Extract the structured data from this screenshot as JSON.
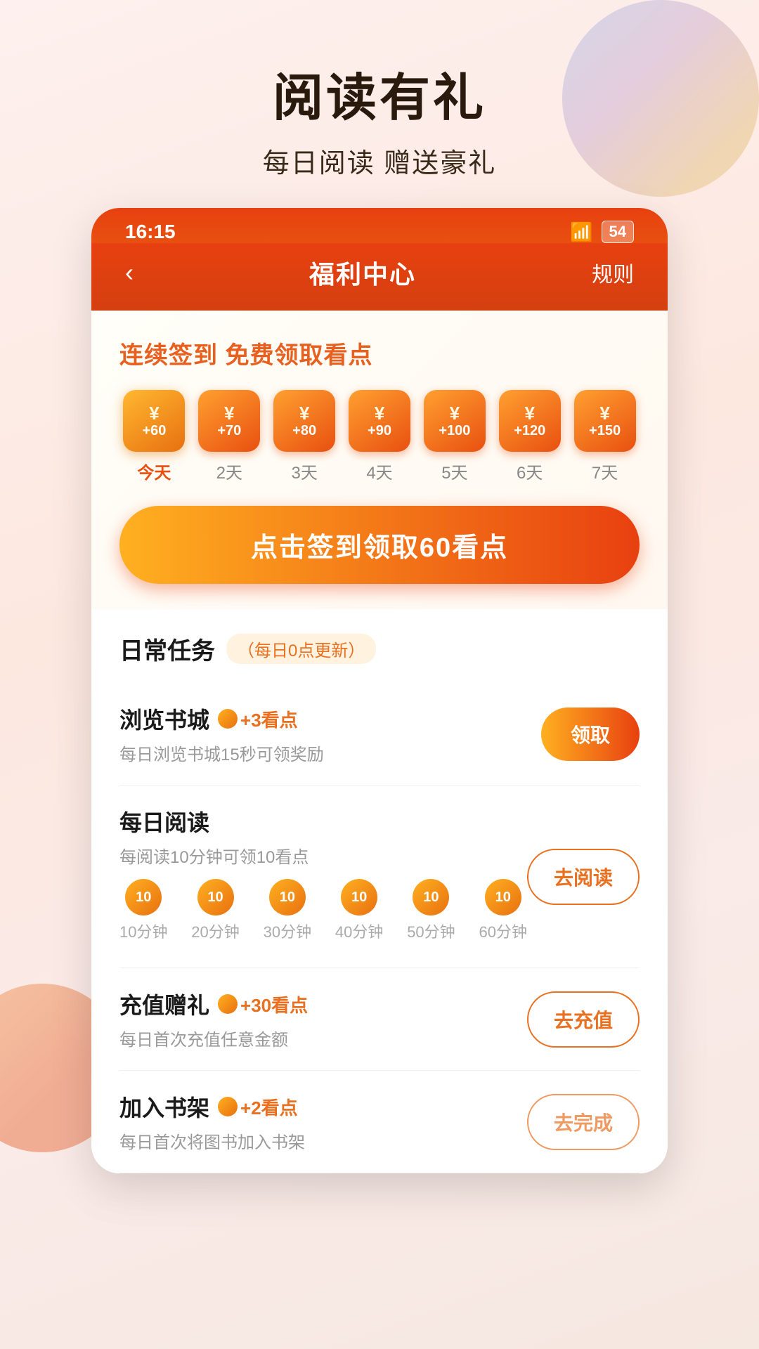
{
  "page": {
    "title": "阅读有礼",
    "subtitle": "每日阅读  赠送豪礼",
    "background_gradient": "#fdf0ee"
  },
  "status_bar": {
    "time": "16:15",
    "battery": "54",
    "wifi": "WiFi"
  },
  "nav": {
    "back_icon": "‹",
    "title": "福利中心",
    "rules": "规则"
  },
  "signin": {
    "section_title": "连续签到 免费领取看点",
    "btn_label": "点击签到领取60看点",
    "days": [
      {
        "label": "今天",
        "amount": "+60",
        "active": true
      },
      {
        "label": "2天",
        "amount": "+70",
        "active": false
      },
      {
        "label": "3天",
        "amount": "+80",
        "active": false
      },
      {
        "label": "4天",
        "amount": "+90",
        "active": false
      },
      {
        "label": "5天",
        "amount": "+100",
        "active": false
      },
      {
        "label": "6天",
        "amount": "+120",
        "active": false
      },
      {
        "label": "7天",
        "amount": "+150",
        "active": false
      }
    ]
  },
  "daily_tasks": {
    "section_title": "日常任务",
    "update_tag": "（每日0点更新）",
    "tasks": [
      {
        "name": "浏览书城",
        "points": "+3看点",
        "desc": "每日浏览书城15秒可领奖励",
        "btn_label": "领取",
        "btn_type": "primary"
      },
      {
        "name": "每日阅读",
        "points": "",
        "desc": "每阅读10分钟可领10看点",
        "btn_label": "去阅读",
        "btn_type": "outline",
        "reading_progress": [
          {
            "amount": "10",
            "label": "10分钟"
          },
          {
            "amount": "10",
            "label": "20分钟"
          },
          {
            "amount": "10",
            "label": "30分钟"
          },
          {
            "amount": "10",
            "label": "40分钟"
          },
          {
            "amount": "10",
            "label": "50分钟"
          },
          {
            "amount": "10",
            "label": "60分钟"
          }
        ]
      },
      {
        "name": "充值赠礼",
        "points": "+30看点",
        "desc": "每日首次充值任意金额",
        "btn_label": "去充值",
        "btn_type": "outline"
      },
      {
        "name": "加入书架",
        "points": "+2看点",
        "desc": "每日首次将图书加入书架",
        "btn_label": "去完成",
        "btn_type": "disabled"
      }
    ]
  }
}
